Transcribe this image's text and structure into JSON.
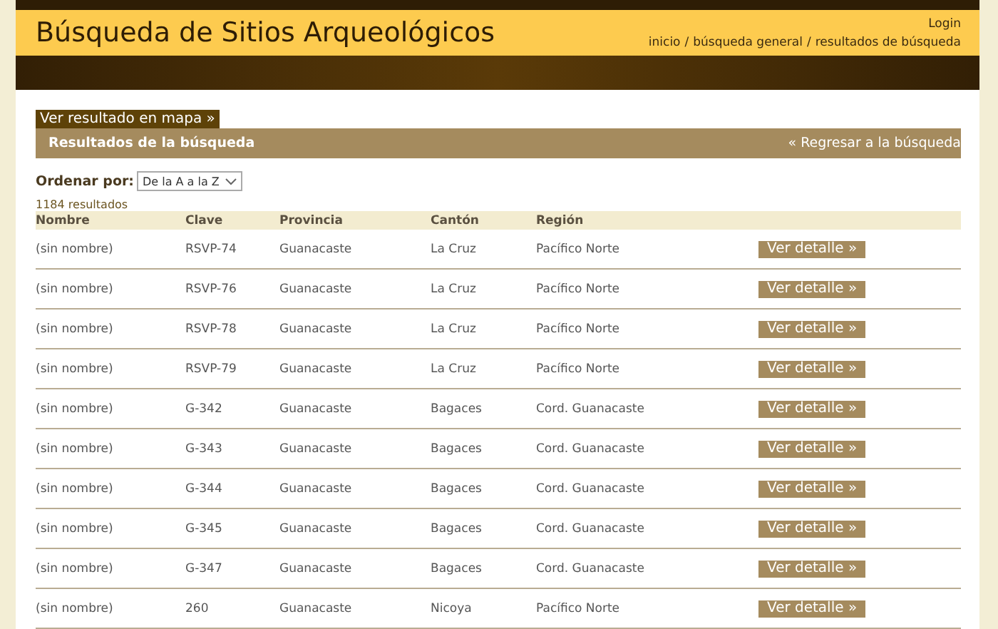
{
  "header": {
    "title": "Búsqueda de Sitios Arqueológicos",
    "login": "Login",
    "breadcrumb": [
      {
        "label": "inicio"
      },
      {
        "label": "búsqueda general"
      },
      {
        "label": "resultados de búsqueda"
      }
    ],
    "separator": "/"
  },
  "map_link": "Ver resultado en mapa »",
  "results_bar": {
    "title": "Resultados de la búsqueda",
    "back_link": "« Regresar a la búsqueda"
  },
  "sort": {
    "label": "Ordenar por:",
    "value": "De la A a la Z"
  },
  "count": "1184 resultados",
  "table": {
    "columns": [
      "Nombre",
      "Clave",
      "Provincia",
      "Cantón",
      "Región"
    ],
    "rows": [
      {
        "cells": [
          "(sin nombre)",
          "RSVP-74",
          "Guanacaste",
          "La Cruz",
          "Pacífico Norte"
        ],
        "action": "Ver detalle »"
      },
      {
        "cells": [
          "(sin nombre)",
          "RSVP-76",
          "Guanacaste",
          "La Cruz",
          "Pacífico Norte"
        ],
        "action": "Ver detalle »"
      },
      {
        "cells": [
          "(sin nombre)",
          "RSVP-78",
          "Guanacaste",
          "La Cruz",
          "Pacífico Norte"
        ],
        "action": "Ver detalle »"
      },
      {
        "cells": [
          "(sin nombre)",
          "RSVP-79",
          "Guanacaste",
          "La Cruz",
          "Pacífico Norte"
        ],
        "action": "Ver detalle »"
      },
      {
        "cells": [
          "(sin nombre)",
          "G-342",
          "Guanacaste",
          "Bagaces",
          "Cord. Guanacaste"
        ],
        "action": "Ver detalle »"
      },
      {
        "cells": [
          "(sin nombre)",
          "G-343",
          "Guanacaste",
          "Bagaces",
          "Cord. Guanacaste"
        ],
        "action": "Ver detalle »"
      },
      {
        "cells": [
          "(sin nombre)",
          "G-344",
          "Guanacaste",
          "Bagaces",
          "Cord. Guanacaste"
        ],
        "action": "Ver detalle »"
      },
      {
        "cells": [
          "(sin nombre)",
          "G-345",
          "Guanacaste",
          "Bagaces",
          "Cord. Guanacaste"
        ],
        "action": "Ver detalle »"
      },
      {
        "cells": [
          "(sin nombre)",
          "G-347",
          "Guanacaste",
          "Bagaces",
          "Cord. Guanacaste"
        ],
        "action": "Ver detalle »"
      },
      {
        "cells": [
          "(sin nombre)",
          "260",
          "Guanacaste",
          "Nicoya",
          "Pacífico Norte"
        ],
        "action": "Ver detalle »"
      }
    ]
  }
}
